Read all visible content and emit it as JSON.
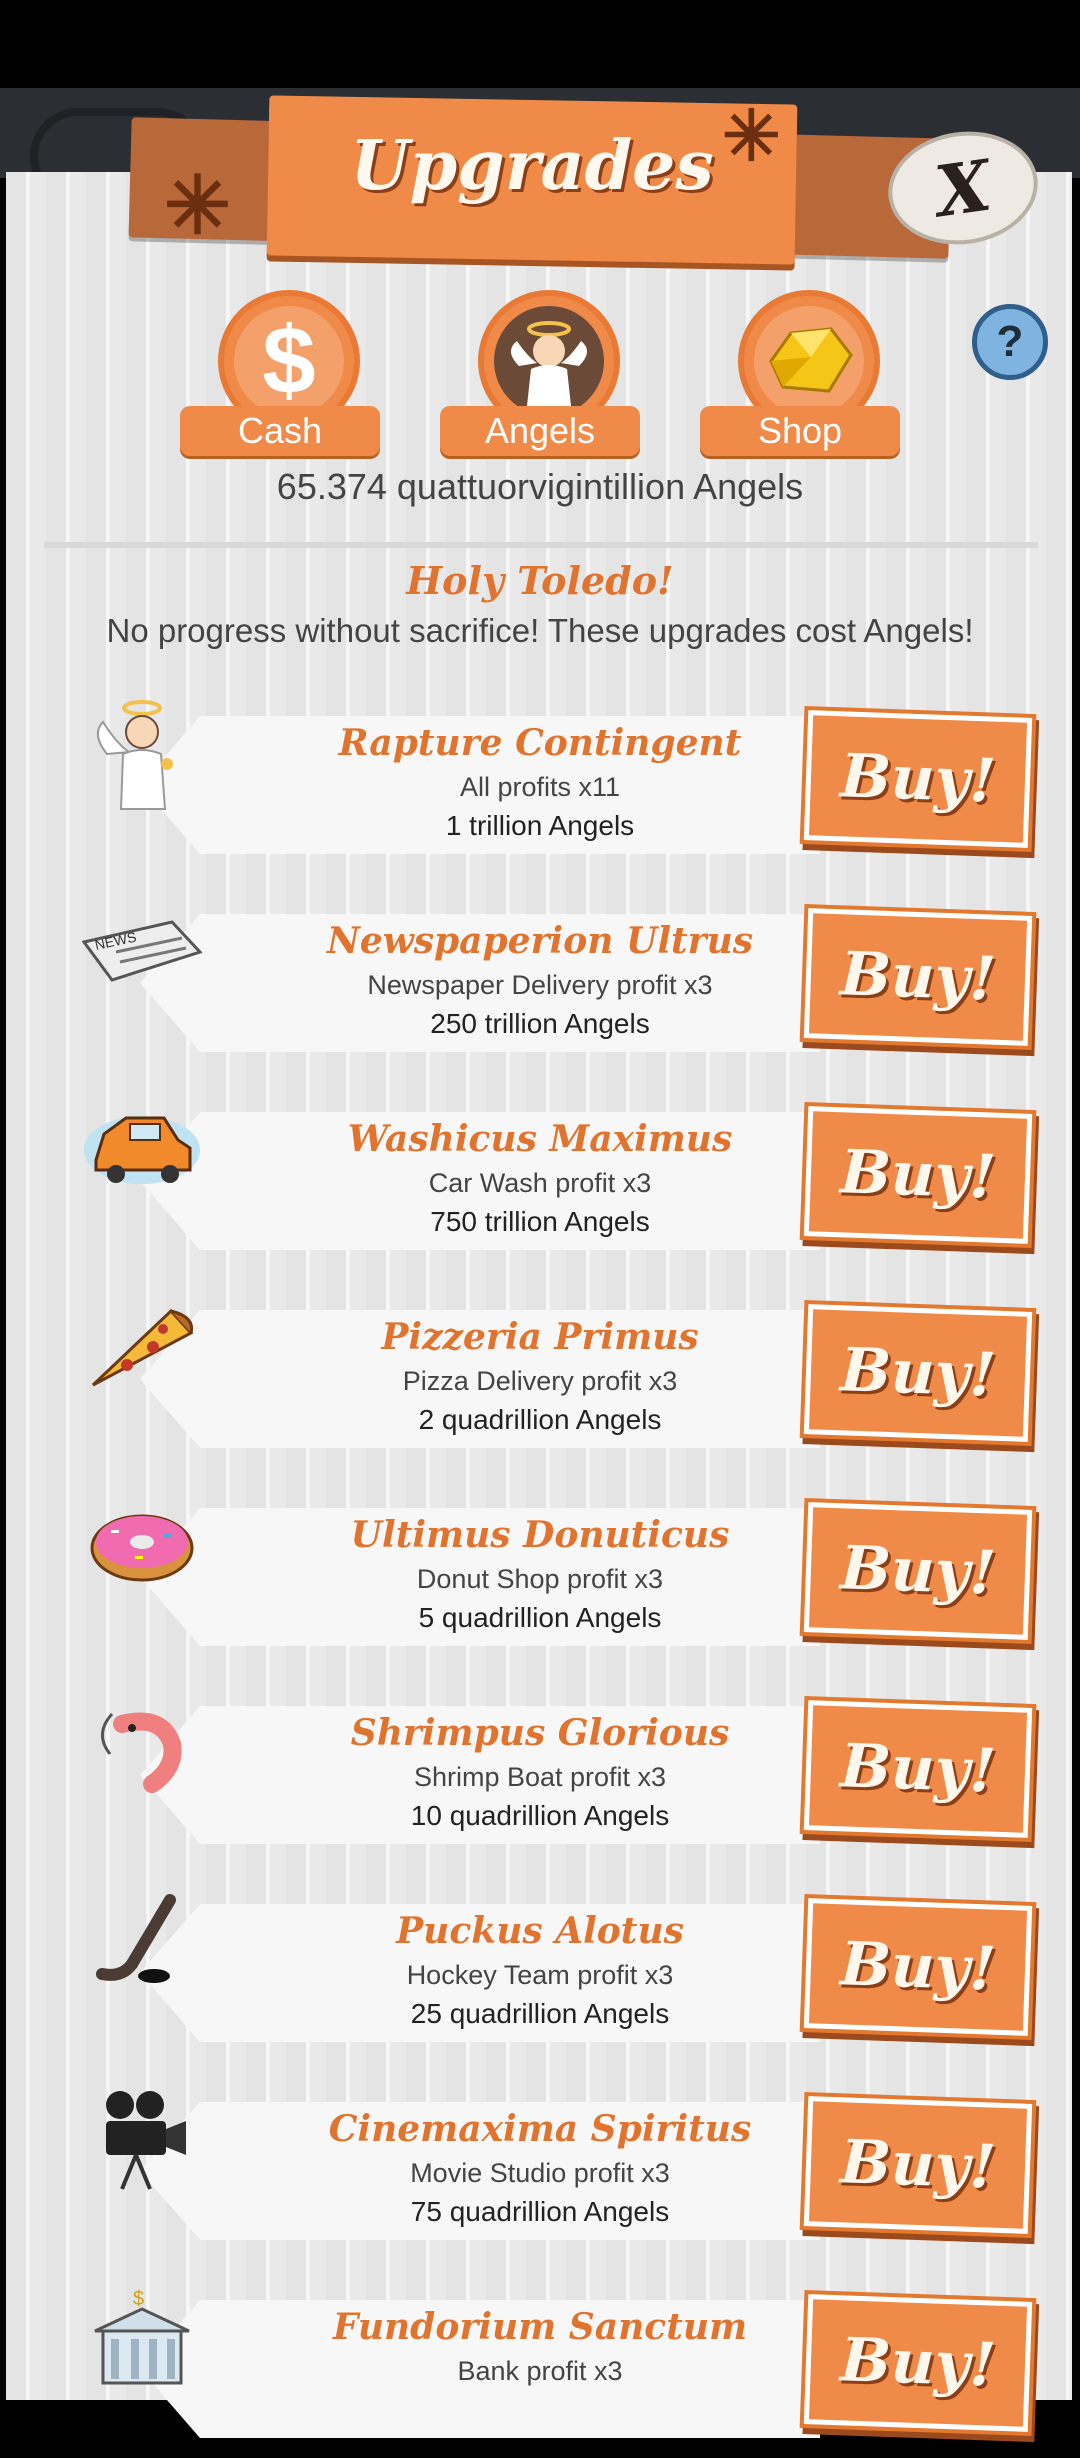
{
  "header": {
    "title": "Upgrades",
    "close_label": "X",
    "help_label": "?"
  },
  "tabs": [
    {
      "label": "Cash",
      "icon": "dollar-icon"
    },
    {
      "label": "Angels",
      "icon": "angel-icon"
    },
    {
      "label": "Shop",
      "icon": "gold-gem-icon"
    }
  ],
  "balance": "65.374 quattuorvigintillion Angels",
  "intro": {
    "title": "Holy Toledo!",
    "subtitle": "No progress without sacrifice! These upgrades cost Angels!"
  },
  "buy_label": "Buy!",
  "upgrades": [
    {
      "name": "Rapture Contingent",
      "desc": "All profits x11",
      "cost": "1 trillion Angels",
      "icon": "angel-icon"
    },
    {
      "name": "Newspaperion Ultrus",
      "desc": "Newspaper Delivery profit x3",
      "cost": "250 trillion Angels",
      "icon": "newspaper-icon"
    },
    {
      "name": "Washicus Maximus",
      "desc": "Car Wash profit x3",
      "cost": "750 trillion Angels",
      "icon": "car-icon"
    },
    {
      "name": "Pizzeria Primus",
      "desc": "Pizza Delivery profit x3",
      "cost": "2 quadrillion Angels",
      "icon": "pizza-icon"
    },
    {
      "name": "Ultimus Donuticus",
      "desc": "Donut Shop profit x3",
      "cost": "5 quadrillion Angels",
      "icon": "donut-icon"
    },
    {
      "name": "Shrimpus Glorious",
      "desc": "Shrimp Boat profit x3",
      "cost": "10 quadrillion Angels",
      "icon": "shrimp-icon"
    },
    {
      "name": "Puckus Alotus",
      "desc": "Hockey Team profit x3",
      "cost": "25 quadrillion Angels",
      "icon": "hockey-stick-icon"
    },
    {
      "name": "Cinemaxima Spiritus",
      "desc": "Movie Studio profit x3",
      "cost": "75 quadrillion Angels",
      "icon": "movie-camera-icon"
    },
    {
      "name": "Fundorium Sanctum",
      "desc": "Bank profit x3",
      "cost": "",
      "icon": "bank-icon"
    }
  ]
}
